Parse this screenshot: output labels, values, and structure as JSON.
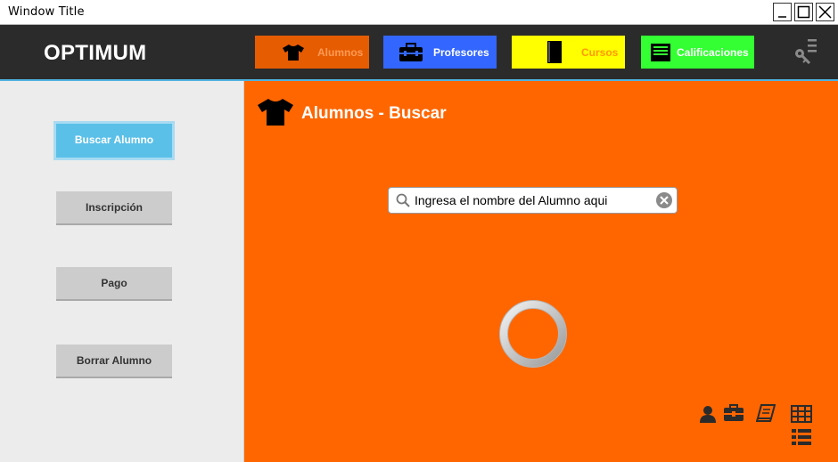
{
  "window": {
    "title": "Window Title",
    "controls": [
      "minimize",
      "maximize",
      "close"
    ]
  },
  "nav": {
    "brand": "OPTIMUM",
    "tabs": [
      {
        "label": "Alumnos",
        "icon": "shirt-icon",
        "bg": "#e65c00",
        "fg": "#ff9a55"
      },
      {
        "label": "Profesores",
        "icon": "briefcase-icon",
        "bg": "#3366ff",
        "fg": "#ffffff"
      },
      {
        "label": "Cursos",
        "icon": "book-icon",
        "bg": "#ffff00",
        "fg": "#ff9900"
      },
      {
        "label": "Calificaciones",
        "icon": "inbox-icon",
        "bg": "#33ff33",
        "fg": "#ffffff"
      }
    ],
    "settings_icon": "key-icon"
  },
  "sidebar": {
    "items": [
      {
        "label": "Buscar Alumno",
        "active": true
      },
      {
        "label": "Inscripción",
        "active": false
      },
      {
        "label": "Pago",
        "active": false
      },
      {
        "label": "Borrar Alumno",
        "active": false
      }
    ]
  },
  "main": {
    "icon": "shirt-icon",
    "title": "Alumnos - Buscar",
    "search": {
      "placeholder": "Ingresa el nombre del Alumno aqui",
      "value": ""
    },
    "loading": true,
    "bottom_icons": [
      "user-icon",
      "briefcase-icon",
      "book-icon",
      "grid-view-icon",
      "list-view-icon"
    ]
  },
  "colors": {
    "main_bg": "#ff6600",
    "nav_bg": "#2b2b2b",
    "accent": "#5bc0e8"
  }
}
